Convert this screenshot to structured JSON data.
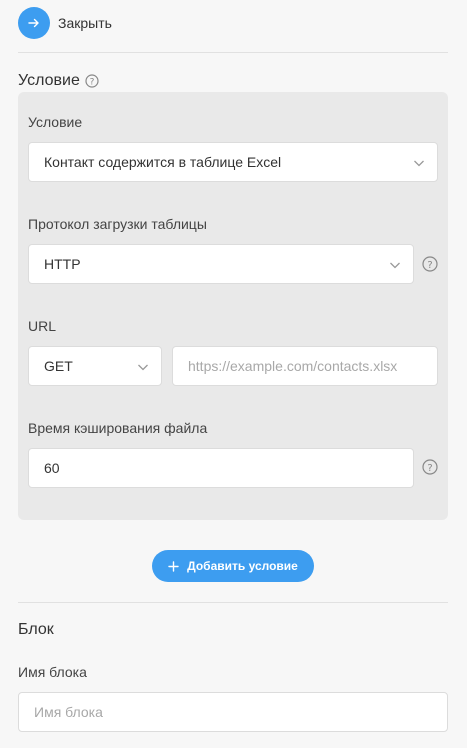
{
  "header": {
    "close_label": "Закрыть"
  },
  "condition_section": {
    "title": "Условие",
    "fields": {
      "condition": {
        "label": "Условие",
        "value": "Контакт содержится в таблице Excel"
      },
      "protocol": {
        "label": "Протокол загрузки таблицы",
        "value": "HTTP"
      },
      "url": {
        "label": "URL",
        "method": "GET",
        "placeholder": "https://example.com/contacts.xlsx"
      },
      "cache_time": {
        "label": "Время кэширования файла",
        "value": "60"
      }
    },
    "add_condition_label": "Добавить условие"
  },
  "block_section": {
    "title": "Блок",
    "name_label": "Имя блока",
    "name_placeholder": "Имя блока"
  },
  "colors": {
    "accent": "#3d9df0",
    "panel_bg": "#e9e9e9",
    "page_bg": "#f7f7f7"
  }
}
